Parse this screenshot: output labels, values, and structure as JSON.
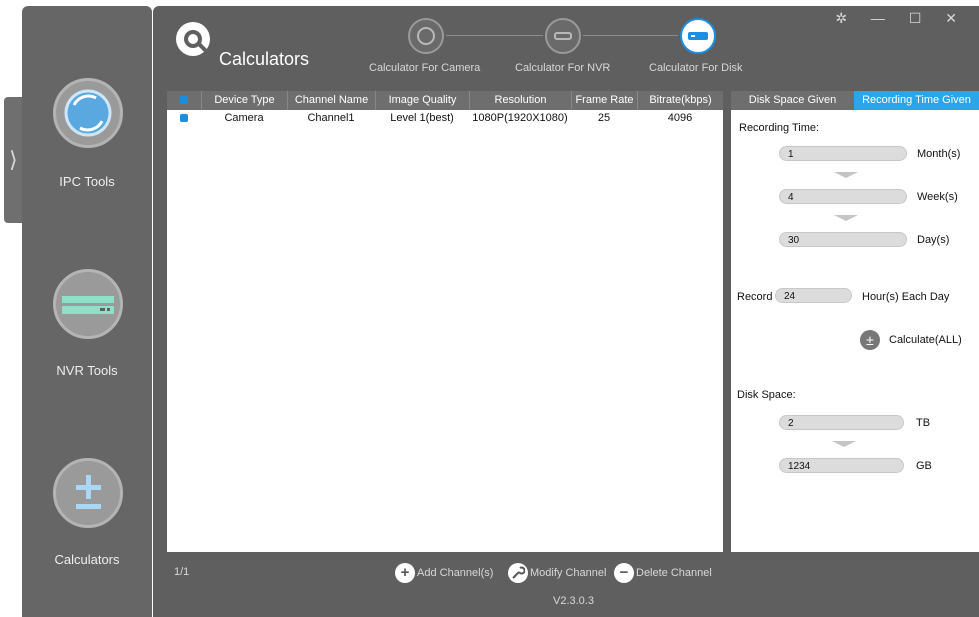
{
  "app": {
    "title": "Calculators",
    "window_controls": "✲ — ☐ ✕",
    "version": "V2.3.0.3"
  },
  "sidebar": {
    "expand_glyph": "⟩",
    "tools": [
      {
        "label": "IPC Tools",
        "icon": "camera-lens-icon"
      },
      {
        "label": "NVR Tools",
        "icon": "nvr-device-icon"
      },
      {
        "label": "Calculators",
        "icon": "plus-minus-icon"
      }
    ]
  },
  "steps": [
    {
      "label": "Calculator For Camera",
      "icon": "camera-lens-icon"
    },
    {
      "label": "Calculator For NVR",
      "icon": "nvr-device-icon"
    },
    {
      "label": "Calculator For Disk",
      "icon": "disk-icon",
      "active": true
    }
  ],
  "table": {
    "columns": [
      "Device Type",
      "Channel Name",
      "Image Quality",
      "Resolution",
      "Frame Rate",
      "Bitrate(kbps)"
    ],
    "rows": [
      {
        "device_type": "Camera",
        "channel_name": "Channel1",
        "image_quality": "Level 1(best)",
        "resolution": "1080P(1920X1080)",
        "frame_rate": "25",
        "bitrate": "4096"
      }
    ]
  },
  "right_panel": {
    "tabs": [
      "Disk Space Given",
      "Recording Time Given"
    ],
    "active_tab": "Recording Time Given",
    "recording_time_label": "Recording Time:",
    "months": {
      "value": "1",
      "unit": "Month(s)"
    },
    "weeks": {
      "value": "4",
      "unit": "Week(s)"
    },
    "days": {
      "value": "30",
      "unit": "Day(s)"
    },
    "record_label": "Record",
    "hours": {
      "value": "24",
      "unit": "Hour(s) Each Day"
    },
    "calc_button": "Calculate(ALL)",
    "calc_button_glyph": "±",
    "disk_space_label": "Disk Space:",
    "tb": {
      "value": "2",
      "unit": "TB"
    },
    "gb": {
      "value": "1234",
      "unit": "GB"
    }
  },
  "bottom": {
    "page": "1/1",
    "add_label": "Add Channel(s)",
    "modify_label": "Modify Channel",
    "delete_label": "Delete Channel",
    "add_glyph": "+",
    "delete_glyph": "−"
  },
  "colors": {
    "accent": "#29a5ec",
    "panel_dark": "#5f5f5f",
    "sidebar": "#666666"
  }
}
